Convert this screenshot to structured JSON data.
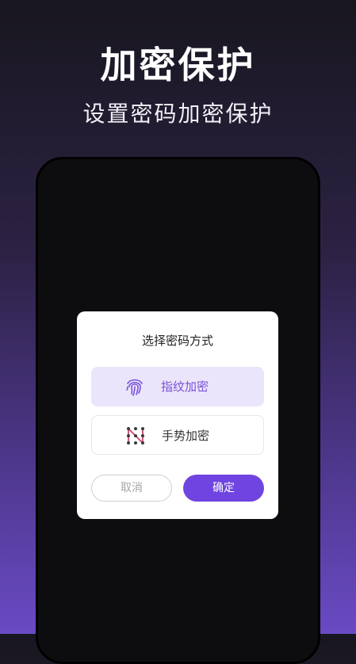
{
  "header": {
    "title": "加密保护",
    "subtitle": "设置密码加密保护"
  },
  "dialog": {
    "title": "选择密码方式",
    "options": [
      {
        "label": "指纹加密",
        "icon": "fingerprint-icon",
        "selected": true
      },
      {
        "label": "手势加密",
        "icon": "gesture-pattern-icon",
        "selected": false
      }
    ],
    "cancel_label": "取消",
    "confirm_label": "确定"
  },
  "colors": {
    "accent": "#7044e0",
    "selected_bg": "#ebe5fb",
    "gesture_icon": "#c84a6a"
  }
}
